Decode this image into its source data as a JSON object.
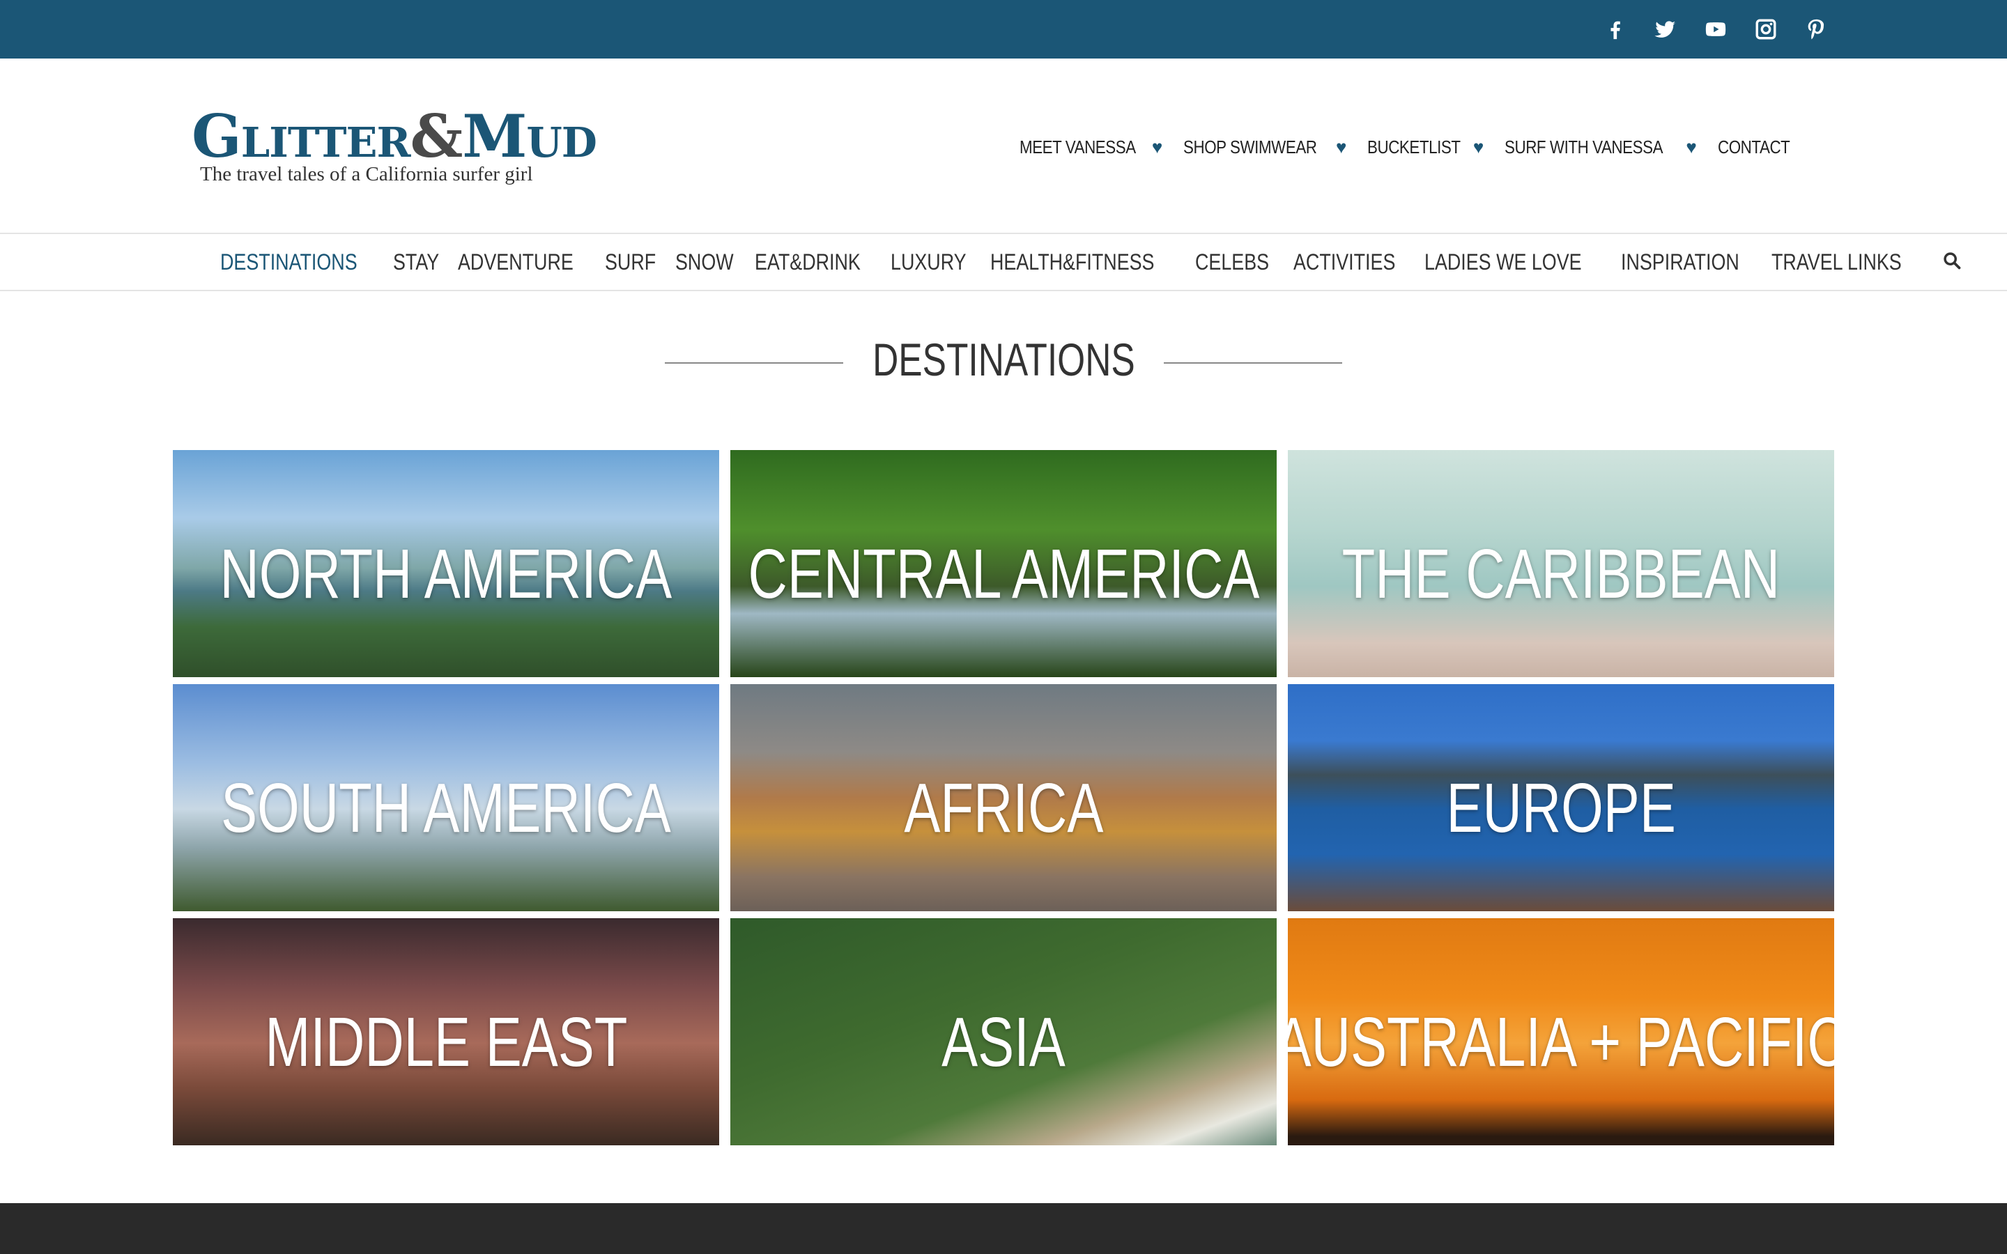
{
  "topbar": {
    "social": [
      "facebook-icon",
      "twitter-icon",
      "youtube-icon",
      "instagram-icon",
      "pinterest-icon"
    ],
    "bg_color": "#1b5676"
  },
  "logo": {
    "main_part1": "Glitter",
    "amp": "&",
    "main_part2": "Mud",
    "tagline": "The travel tales of a California surfer girl"
  },
  "topnav": {
    "items": [
      {
        "label": "MEET VANESSA",
        "has_dropdown": true
      },
      {
        "label": "SHOP SWIMWEAR",
        "has_dropdown": true
      },
      {
        "label": "BUCKETLIST",
        "has_dropdown": true
      },
      {
        "label": "SURF WITH VANESSA",
        "has_dropdown": true
      },
      {
        "label": "CONTACT",
        "has_dropdown": false
      }
    ],
    "heart": "♥"
  },
  "catnav": {
    "items": [
      "DESTINATIONS",
      "STAY",
      "ADVENTURE",
      "SURF",
      "SNOW",
      "EAT&DRINK",
      "LUXURY",
      "HEALTH&FITNESS",
      "CELEBS",
      "ACTIVITIES",
      "LADIES WE LOVE",
      "INSPIRATION",
      "TRAVEL LINKS"
    ],
    "active": "DESTINATIONS",
    "accent": "#1b5676"
  },
  "section_title": "DESTINATIONS",
  "destinations": [
    {
      "label": "NORTH AMERICA"
    },
    {
      "label": "CENTRAL AMERICA"
    },
    {
      "label": "THE CARIBBEAN"
    },
    {
      "label": "SOUTH AMERICA"
    },
    {
      "label": "AFRICA"
    },
    {
      "label": "EUROPE"
    },
    {
      "label": "MIDDLE EAST"
    },
    {
      "label": "ASIA"
    },
    {
      "label": "AUSTRALIA + PACIFIC"
    }
  ]
}
